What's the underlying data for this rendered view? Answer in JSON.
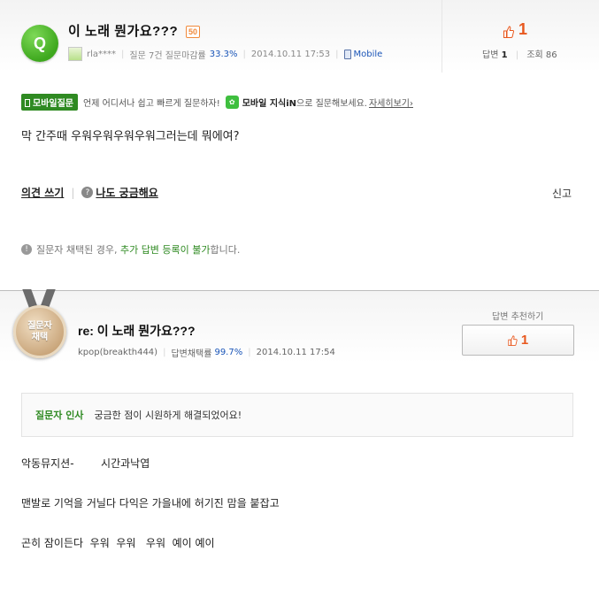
{
  "question": {
    "badge": "Q",
    "title": "이 노래 뭔가요???",
    "points": "50",
    "author": "rla****",
    "author_stats_label": "질문 7건 질문마감률",
    "author_rate": "33.3%",
    "date": "2014.10.11 17:53",
    "device": "Mobile",
    "like_count": "1",
    "answers_label": "답변",
    "answers_count": "1",
    "views_label": "조회",
    "views_count": "86",
    "body": "막 간주때 우워우워우워우워그러는데 뭐에여?"
  },
  "promo": {
    "tag": "모바일질문",
    "text1": "언제 어디서나 쉽고 빠르게 질문하자!",
    "kin_label": "모바일 지식iN",
    "text2": "으로 질문해보세요.",
    "link": "자세히보기›"
  },
  "actions": {
    "comment": "의견 쓰기",
    "curious": "나도 궁금해요",
    "report": "신고"
  },
  "notice": {
    "pre": "질문자 채택된 경우,",
    "highlight": "추가 답변 등록이 불가",
    "post": "합니다."
  },
  "answer": {
    "medal_line1": "질문자",
    "medal_line2": "채택",
    "title": "re: 이 노래 뭔가요???",
    "author": "kpop(breakth444)",
    "adopt_label": "답변채택률",
    "adopt_rate": "99.7%",
    "date": "2014.10.11 17:54",
    "recommend_label": "답변 추천하기",
    "recommend_count": "1",
    "greeting_label": "질문자 인사",
    "greeting_text": "궁금한 점이 시원하게 해결되었어요!",
    "lines": [
      "악동뮤지션-        시간과낙엽",
      "맨발로 기억을 거닐다 다익은 가을내에 허기진 맘을 붙잡고",
      "곤히 잠이든다  우워  우워   우워  예이 예이"
    ]
  }
}
